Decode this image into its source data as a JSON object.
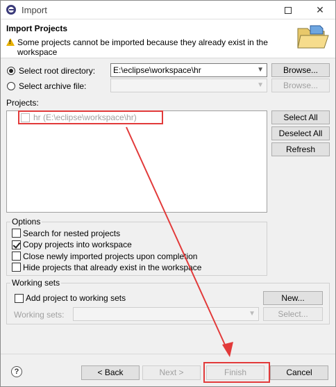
{
  "window": {
    "title": "Import"
  },
  "header": {
    "title": "Import Projects",
    "message": "Some projects cannot be imported because they already exist in the workspace"
  },
  "source": {
    "root_dir_label": "Select root directory:",
    "root_dir_value": "E:\\eclipse\\workspace\\hr",
    "archive_label": "Select archive file:",
    "archive_value": "",
    "browse_label": "Browse...",
    "browse_archive_label": "Browse..."
  },
  "projects": {
    "label": "Projects:",
    "items": [
      {
        "label": "hr (E:\\eclipse\\workspace\\hr)",
        "checked": false,
        "enabled": false
      }
    ],
    "select_all": "Select All",
    "deselect_all": "Deselect All",
    "refresh": "Refresh"
  },
  "options": {
    "title": "Options",
    "items": [
      {
        "label": "Search for nested projects",
        "checked": false
      },
      {
        "label": "Copy projects into workspace",
        "checked": true
      },
      {
        "label": "Close newly imported projects upon completion",
        "checked": false
      },
      {
        "label": "Hide projects that already exist in the workspace",
        "checked": false
      }
    ]
  },
  "working_sets": {
    "title": "Working sets",
    "add_label": "Add project to working sets",
    "new_button": "New...",
    "sets_label": "Working sets:",
    "select_button": "Select..."
  },
  "footer": {
    "help": "?",
    "back": "< Back",
    "next": "Next >",
    "finish": "Finish",
    "cancel": "Cancel"
  },
  "colors": {
    "annotation_red": "#e23a3a",
    "warning_yellow": "#e8b100"
  }
}
